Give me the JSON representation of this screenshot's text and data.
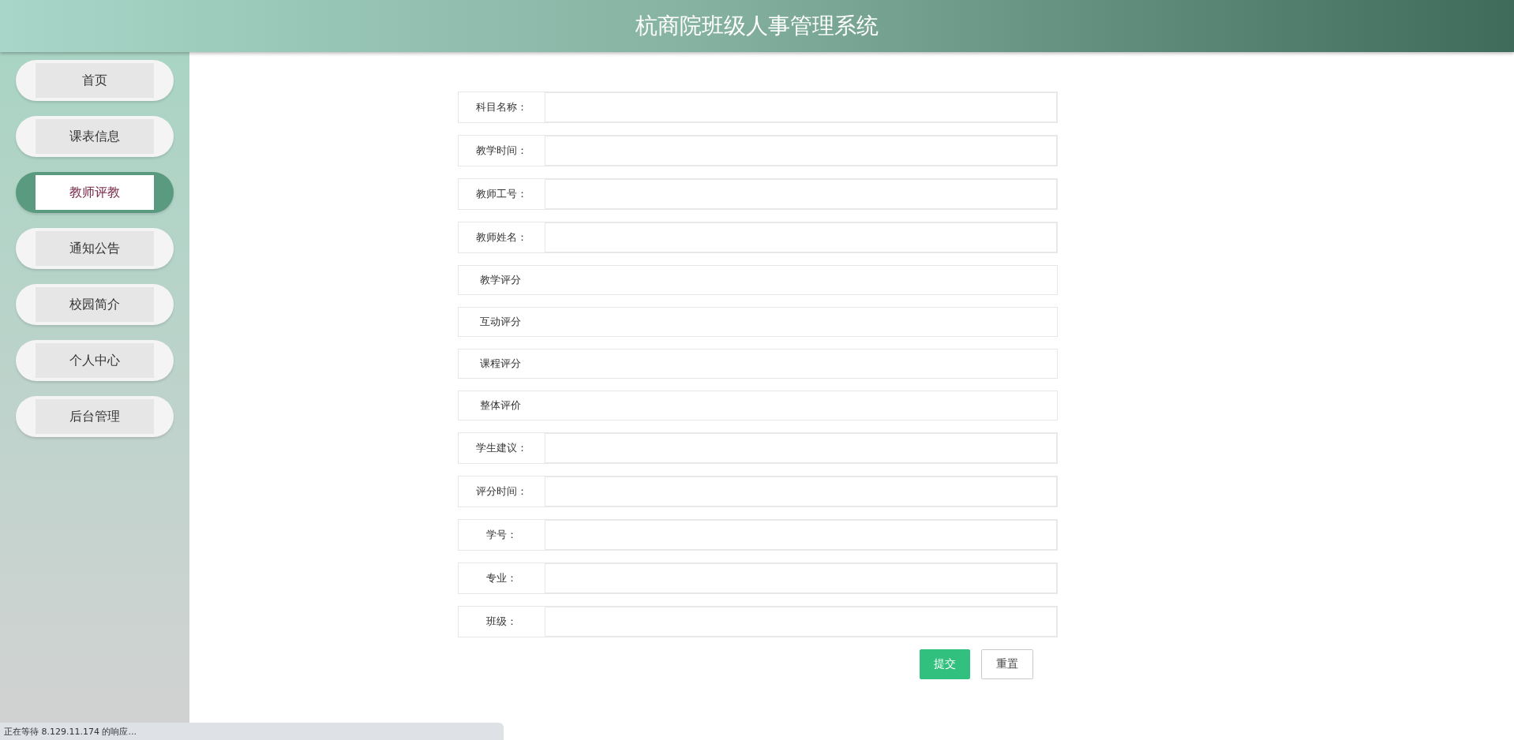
{
  "header": {
    "title": "杭商院班级人事管理系统"
  },
  "sidebar": {
    "items": [
      {
        "label": "首页",
        "selected": false
      },
      {
        "label": "课表信息",
        "selected": false
      },
      {
        "label": "教师评教",
        "selected": true
      },
      {
        "label": "通知公告",
        "selected": false
      },
      {
        "label": "校园简介",
        "selected": false
      },
      {
        "label": "个人中心",
        "selected": false
      },
      {
        "label": "后台管理",
        "selected": false
      }
    ]
  },
  "form": {
    "rows": [
      {
        "kind": "input",
        "label": "科目名称："
      },
      {
        "kind": "input",
        "label": "教学时间："
      },
      {
        "kind": "input",
        "label": "教师工号："
      },
      {
        "kind": "input",
        "label": "教师姓名："
      },
      {
        "kind": "rating",
        "label": "教学评分"
      },
      {
        "kind": "rating",
        "label": "互动评分"
      },
      {
        "kind": "rating",
        "label": "课程评分"
      },
      {
        "kind": "rating",
        "label": "整体评价"
      },
      {
        "kind": "input",
        "label": "学生建议："
      },
      {
        "kind": "input",
        "label": "评分时间："
      },
      {
        "kind": "input",
        "label": "学号："
      },
      {
        "kind": "input",
        "label": "专业："
      },
      {
        "kind": "input",
        "label": "班级："
      }
    ],
    "buttons": [
      {
        "kind": "primary",
        "label": "提交"
      },
      {
        "kind": "default",
        "label": "重置"
      }
    ]
  },
  "status_bar": {
    "text": "正在等待 8.129.11.174 的响应..."
  }
}
